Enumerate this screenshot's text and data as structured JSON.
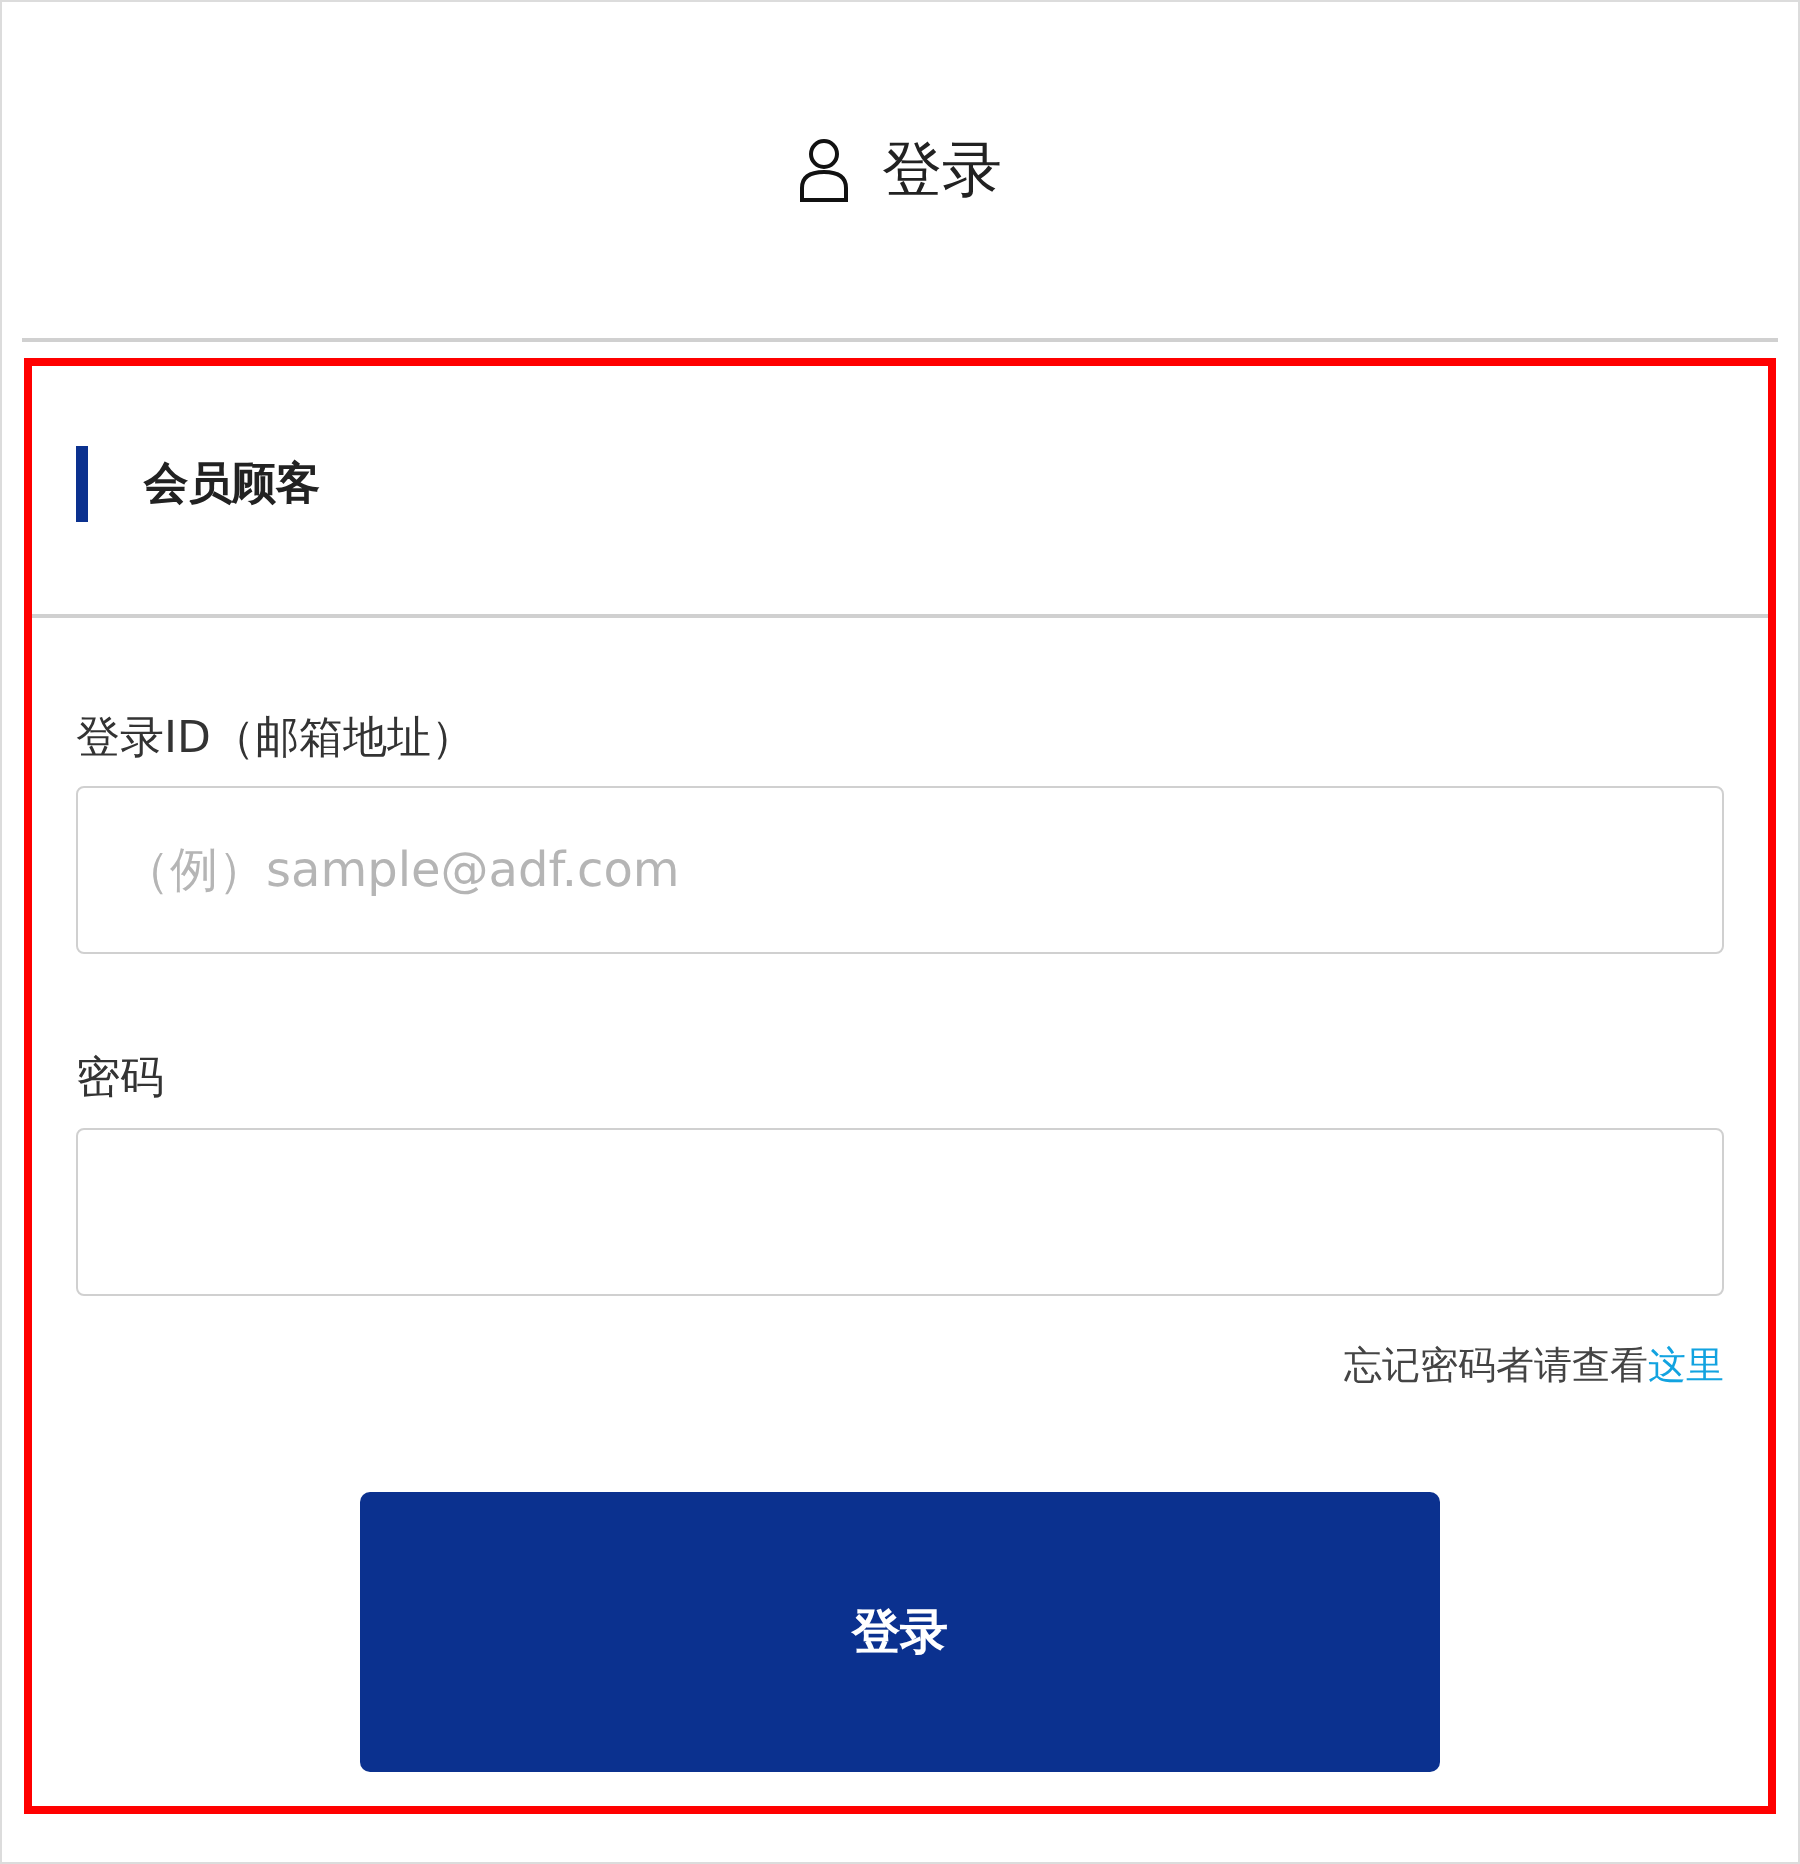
{
  "header": {
    "title": "登录"
  },
  "section": {
    "title": "会员顾客"
  },
  "fields": [
    {
      "label": "登录ID（邮箱地址）",
      "placeholder": "（例）sample@adf.com"
    },
    {
      "label": "密码"
    }
  ],
  "forgot": {
    "text": "忘记密码者请查看",
    "link": "这里"
  },
  "submit": {
    "label": "登录"
  }
}
